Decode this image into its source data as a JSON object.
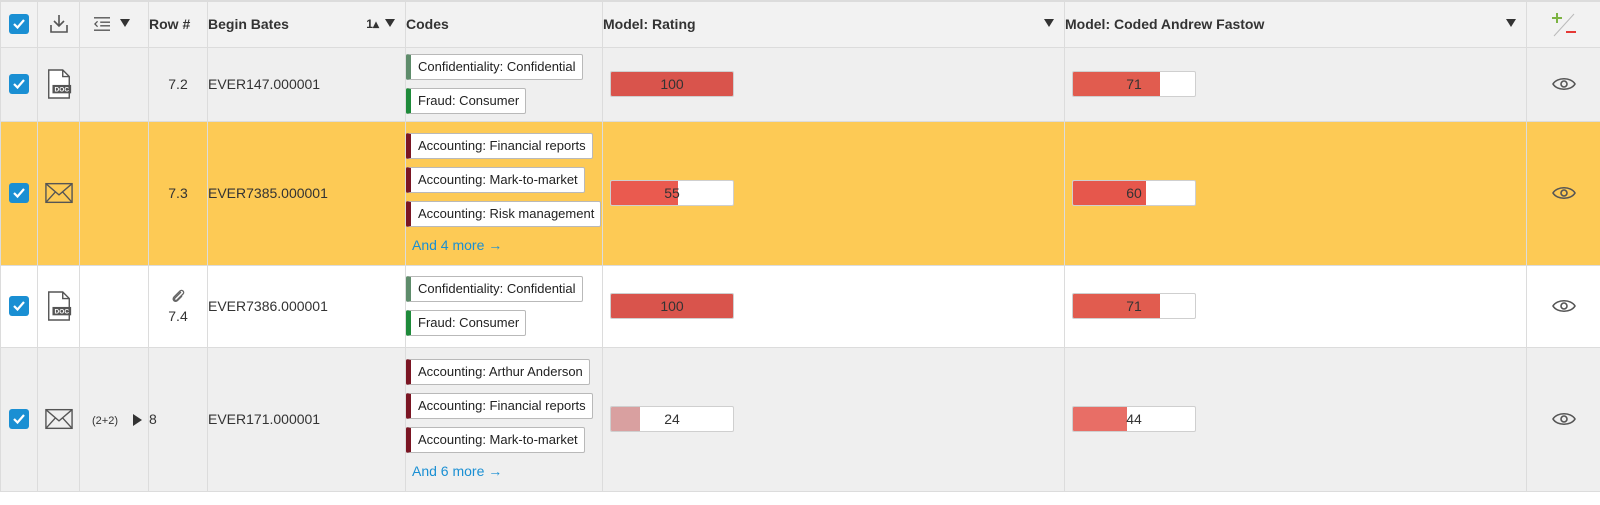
{
  "header": {
    "row_label": "Row #",
    "begin_bates_label": "Begin Bates",
    "sort_indicator": "1▴",
    "codes_label": "Codes",
    "model_rating_label": "Model: Rating",
    "model_coded_label": "Model: Coded Andrew Fastow"
  },
  "colors": {
    "accent": "#1a8fd3",
    "highlight_row": "#fdca55",
    "chip_accounting": "#7a1523",
    "chip_confidentiality": "#5e8c6b",
    "chip_fraud": "#1e8a3a"
  },
  "rows": [
    {
      "row": "7.2",
      "bates": "EVER147.000001",
      "icon": "doc-icon",
      "codes": [
        "Confidentiality: Confidential",
        "Fraud: Consumer"
      ],
      "more": "",
      "rating": 100,
      "rating_label": "100",
      "coded": 71,
      "coded_label": "71"
    },
    {
      "row": "7.3",
      "bates": "EVER7385.000001",
      "icon": "email-icon",
      "codes": [
        "Accounting: Financial reports",
        "Accounting: Mark-to-market",
        "Accounting: Risk management"
      ],
      "more": "And 4 more →",
      "rating": 55,
      "rating_label": "55",
      "coded": 60,
      "coded_label": "60"
    },
    {
      "row": "7.4",
      "bates": "EVER7386.000001",
      "icon": "doc-icon",
      "codes": [
        "Confidentiality: Confidential",
        "Fraud: Consumer"
      ],
      "more": "",
      "rating": 100,
      "rating_label": "100",
      "coded": 71,
      "coded_label": "71"
    },
    {
      "row": "8",
      "bates": "EVER171.000001",
      "icon": "email-icon",
      "family": "(2+2)",
      "codes": [
        "Accounting: Arthur Anderson",
        "Accounting: Financial reports",
        "Accounting: Mark-to-market"
      ],
      "more": "And 6 more →",
      "rating": 24,
      "rating_label": "24",
      "coded": 44,
      "coded_label": "44"
    }
  ]
}
